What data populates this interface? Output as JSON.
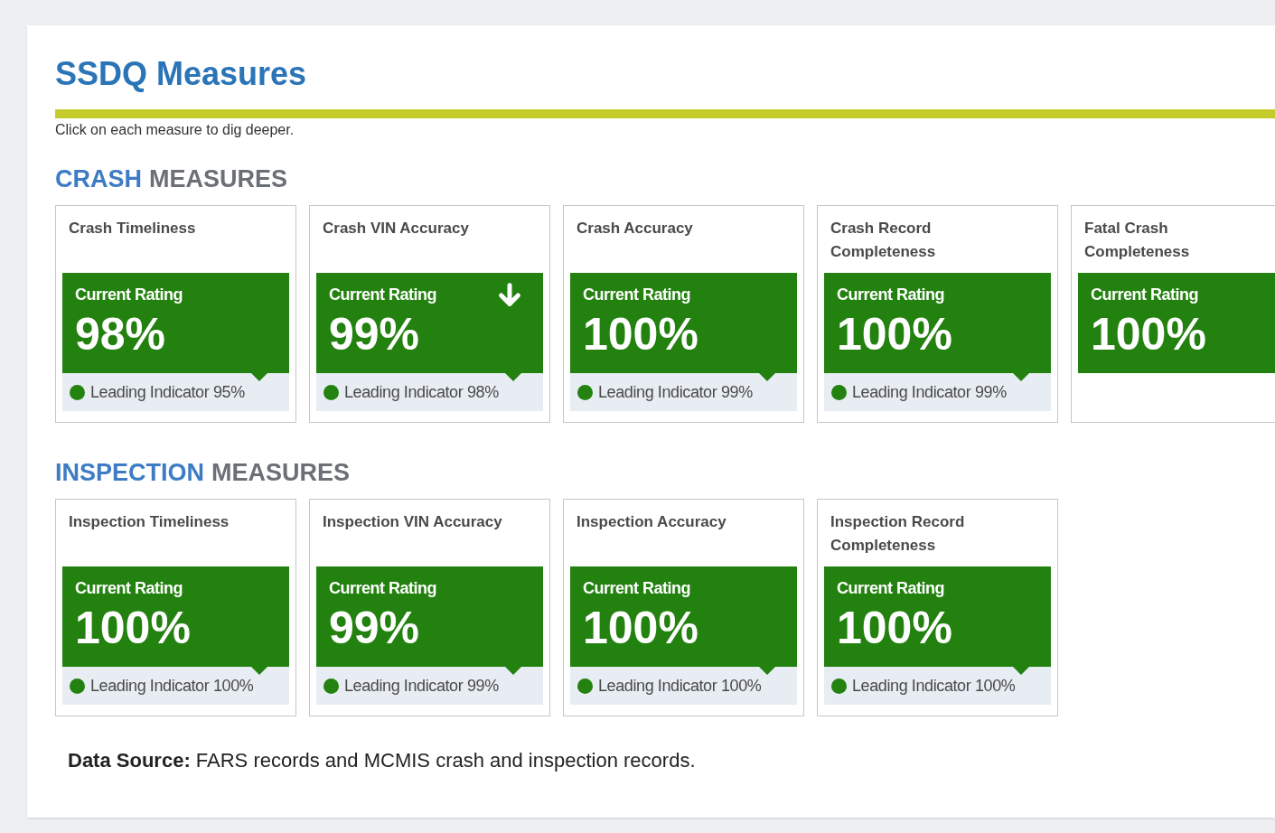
{
  "title": "SSDQ Measures",
  "instruction": "Click on each measure to dig deeper.",
  "sections": [
    {
      "heading": {
        "highlight": "CRASH",
        "rest": "MEASURES"
      },
      "cards": [
        {
          "title": "Crash Timeliness",
          "rating_label": "Current Rating",
          "rating": "98%",
          "leading_indicator": "Leading Indicator 95%"
        },
        {
          "title": "Crash VIN Accuracy",
          "rating_label": "Current Rating",
          "rating": "99%",
          "declining": true,
          "leading_indicator": "Leading Indicator 98%"
        },
        {
          "title": "Crash Accuracy",
          "rating_label": "Current Rating",
          "rating": "100%",
          "leading_indicator": "Leading Indicator 99%"
        },
        {
          "title": "Crash Record Completeness",
          "rating_label": "Current Rating",
          "rating": "100%",
          "leading_indicator": "Leading Indicator 99%"
        },
        {
          "title": "Fatal Crash Completeness",
          "rating_label": "Current Rating",
          "rating": "100%"
        }
      ]
    },
    {
      "heading": {
        "highlight": "INSPECTION",
        "rest": "MEASURES"
      },
      "cards": [
        {
          "title": "Inspection Timeliness",
          "rating_label": "Current Rating",
          "rating": "100%",
          "leading_indicator": "Leading Indicator 100%"
        },
        {
          "title": "Inspection VIN Accuracy",
          "rating_label": "Current Rating",
          "rating": "99%",
          "leading_indicator": "Leading Indicator 99%"
        },
        {
          "title": "Inspection Accuracy",
          "rating_label": "Current Rating",
          "rating": "100%",
          "leading_indicator": "Leading Indicator 100%"
        },
        {
          "title": "Inspection Record Completeness",
          "rating_label": "Current Rating",
          "rating": "100%",
          "leading_indicator": "Leading Indicator 100%"
        }
      ]
    }
  ],
  "data_source": "**Data Source:** FARS records and MCMIS crash and inspection records."
}
